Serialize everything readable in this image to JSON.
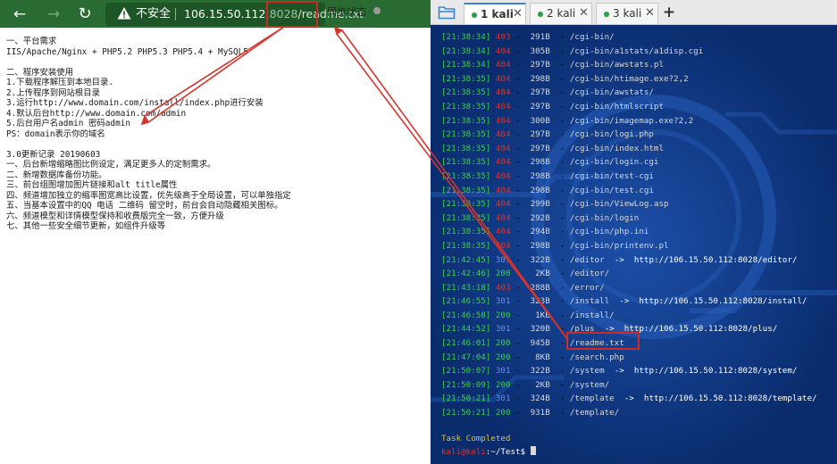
{
  "browser": {
    "security_label": "不安全",
    "url_host": "106.15.50.112",
    "url_port": ":8028",
    "url_path": "/readme.txt",
    "sync_label": "同步状态",
    "colors": {
      "toolbar": "#2a6b33",
      "highlight": "#cc2a22"
    }
  },
  "readme": {
    "lines": [
      "一、平台需求",
      "IIS/Apache/Nginx + PHP5.2 PHP5.3 PHP5.4 + MySQL5",
      "",
      "二、程序安装使用",
      "1.下载程序解压到本地目录.",
      "2.上传程序到网站根目录",
      "3.运行http://www.domain.com/install/index.php进行安装",
      "4.默认后台http://www.domain.com/admin",
      "5.后台用户名admin 密码admin",
      "PS：domain表示你的域名",
      "",
      "3.0更新记录 20190603",
      "一、后台新增缩略图比例设定，满足更多人的定制需求。",
      "二、新增数据库备份功能。",
      "三、前台组图增加图片链接和alt title属性",
      "四、频道增加独立的缩率图宽高比设置，优先级高于全局设置，可以单独指定",
      "五、当基本设置中的QQ 电话 二维码 留空时，前台会自动隐藏相关图标。",
      "六、频道模型和详情模型保持和收费版完全一致，方便升级",
      "七、其他一些安全细节更新，如组件升级等"
    ]
  },
  "terminal": {
    "tabs": [
      {
        "label": "1 kali",
        "close": "✕"
      },
      {
        "label": "2 kali",
        "close": "✕"
      },
      {
        "label": "3 kali",
        "close": "✕"
      }
    ],
    "new_tab": "+",
    "lines": [
      {
        "time": "[21:38:34]",
        "code": "403",
        "size": "291B",
        "path": "/cgi-bin/",
        "redirect": "",
        "tone": "red"
      },
      {
        "time": "[21:38:34]",
        "code": "404",
        "size": "305B",
        "path": "/cgi-bin/a1stats/a1disp.cgi",
        "redirect": "",
        "tone": "red"
      },
      {
        "time": "[21:38:34]",
        "code": "404",
        "size": "297B",
        "path": "/cgi-bin/awstats.pl",
        "redirect": "",
        "tone": "red"
      },
      {
        "time": "[21:38:35]",
        "code": "404",
        "size": "298B",
        "path": "/cgi-bin/htimage.exe?2,2",
        "redirect": "",
        "tone": "red"
      },
      {
        "time": "[21:38:35]",
        "code": "404",
        "size": "297B",
        "path": "/cgi-bin/awstats/",
        "redirect": "",
        "tone": "red"
      },
      {
        "time": "[21:38:35]",
        "code": "404",
        "size": "297B",
        "path": "/cgi-bin/htmlscript",
        "redirect": "",
        "tone": "red"
      },
      {
        "time": "[21:38:35]",
        "code": "404",
        "size": "300B",
        "path": "/cgi-bin/imagemap.exe?2,2",
        "redirect": "",
        "tone": "red"
      },
      {
        "time": "[21:38:35]",
        "code": "404",
        "size": "297B",
        "path": "/cgi-bin/logi.php",
        "redirect": "",
        "tone": "red"
      },
      {
        "time": "[21:38:35]",
        "code": "404",
        "size": "297B",
        "path": "/cgi-bin/index.html",
        "redirect": "",
        "tone": "red"
      },
      {
        "time": "[21:38:35]",
        "code": "404",
        "size": "298B",
        "path": "/cgi-bin/login.cgi",
        "redirect": "",
        "tone": "red"
      },
      {
        "time": "[21:38:35]",
        "code": "404",
        "size": "298B",
        "path": "/cgi-bin/test-cgi",
        "redirect": "",
        "tone": "red"
      },
      {
        "time": "[21:38:35]",
        "code": "404",
        "size": "298B",
        "path": "/cgi-bin/test.cgi",
        "redirect": "",
        "tone": "red"
      },
      {
        "time": "[21:38:35]",
        "code": "404",
        "size": "299B",
        "path": "/cgi-bin/ViewLog.asp",
        "redirect": "",
        "tone": "red"
      },
      {
        "time": "[21:38:35]",
        "code": "404",
        "size": "292B",
        "path": "/cgi-bin/login",
        "redirect": "",
        "tone": "red"
      },
      {
        "time": "[21:38:35]",
        "code": "404",
        "size": "294B",
        "path": "/cgi-bin/php.ini",
        "redirect": "",
        "tone": "red"
      },
      {
        "time": "[21:38:35]",
        "code": "404",
        "size": "298B",
        "path": "/cgi-bin/printenv.pl",
        "redirect": "",
        "tone": "red"
      },
      {
        "time": "[21:42:45]",
        "code": "301",
        "size": "322B",
        "path": "/editor",
        "redirect": "http://106.15.50.112:8028/editor/",
        "tone": "blue"
      },
      {
        "time": "[21:42:46]",
        "code": "200",
        "size": "2KB",
        "path": "/editor/",
        "redirect": "",
        "tone": "green"
      },
      {
        "time": "[21:43:18]",
        "code": "403",
        "size": "288B",
        "path": "/error/",
        "redirect": "",
        "tone": "red"
      },
      {
        "time": "[21:46:55]",
        "code": "301",
        "size": "323B",
        "path": "/install",
        "redirect": "http://106.15.50.112:8028/install/",
        "tone": "blue"
      },
      {
        "time": "[21:46:58]",
        "code": "200",
        "size": "1KB",
        "path": "/install/",
        "redirect": "",
        "tone": "green"
      },
      {
        "time": "[21:44:52]",
        "code": "301",
        "size": "320B",
        "path": "/plus",
        "redirect": "http://106.15.50.112:8028/plus/",
        "tone": "blue"
      },
      {
        "time": "[21:46:01]",
        "code": "200",
        "size": "945B",
        "path": "/readme.txt",
        "redirect": "",
        "tone": "green"
      },
      {
        "time": "[21:47:04]",
        "code": "200",
        "size": "8KB",
        "path": "/search.php",
        "redirect": "",
        "tone": "green"
      },
      {
        "time": "[21:50:07]",
        "code": "301",
        "size": "322B",
        "path": "/system",
        "redirect": "http://106.15.50.112:8028/system/",
        "tone": "blue"
      },
      {
        "time": "[21:50:09]",
        "code": "200",
        "size": "2KB",
        "path": "/system/",
        "redirect": "",
        "tone": "green"
      },
      {
        "time": "[21:50:21]",
        "code": "301",
        "size": "324B",
        "path": "/template",
        "redirect": "http://106.15.50.112:8028/template/",
        "tone": "blue"
      },
      {
        "time": "[21:50:21]",
        "code": "200",
        "size": "931B",
        "path": "/template/",
        "redirect": "",
        "tone": "green"
      }
    ],
    "task_completed": "Task Completed",
    "prompt_user": "kali@kali",
    "prompt_path": ":~/Test$",
    "colors": {
      "background": "#0c2f75",
      "timestamp": "#3dd14a",
      "error": "#e0322a",
      "task": "#e6c226"
    }
  }
}
